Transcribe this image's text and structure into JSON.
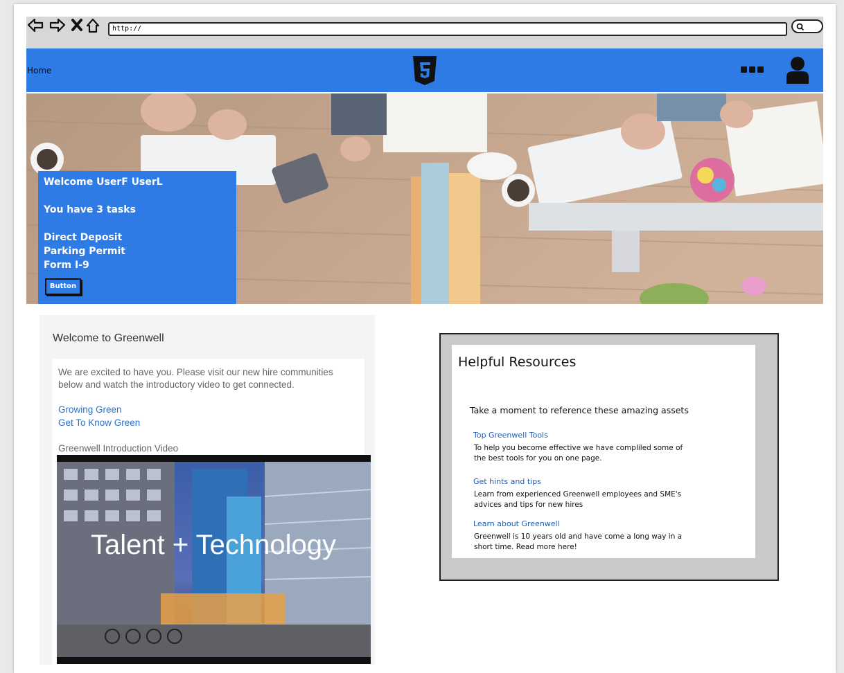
{
  "browser": {
    "url": "http://"
  },
  "header": {
    "home_label": "Home"
  },
  "welcome_card": {
    "greeting": "Welcome UserF UserL",
    "tasks_summary": "You have 3 tasks",
    "tasks": [
      "Direct Deposit",
      "Parking Permit",
      "Form I-9"
    ],
    "button_label": "Button"
  },
  "welcome_panel": {
    "title": "Welcome to Greenwell",
    "intro_text": "We are excited to have you. Please visit our new hire communities below and watch the introductory video to get connected.",
    "links": [
      "Growing Green",
      "Get To Know Green"
    ],
    "video_label": "Greenwell Introduction Video",
    "video_title": "Talent + Technology"
  },
  "resources": {
    "title": "Helpful Resources",
    "subtitle": "Take a moment to reference these amazing assets",
    "items": [
      {
        "link": "Top Greenwell Tools",
        "desc": "To help you become effective we have compliled some of the best tools for you on one page."
      },
      {
        "link": "Get hints and tips",
        "desc": "Learn from experienced Greenwell employees and SME's advices and tips for new hires"
      },
      {
        "link": "Learn about Greenwell",
        "desc": "Greenwell is 10 years old and have come a long way in a short time.  Read more here!"
      }
    ]
  },
  "colors": {
    "header_blue": "#2f7be6",
    "link_blue": "#2a72cc",
    "panel_grey": "#c9c9c9"
  }
}
